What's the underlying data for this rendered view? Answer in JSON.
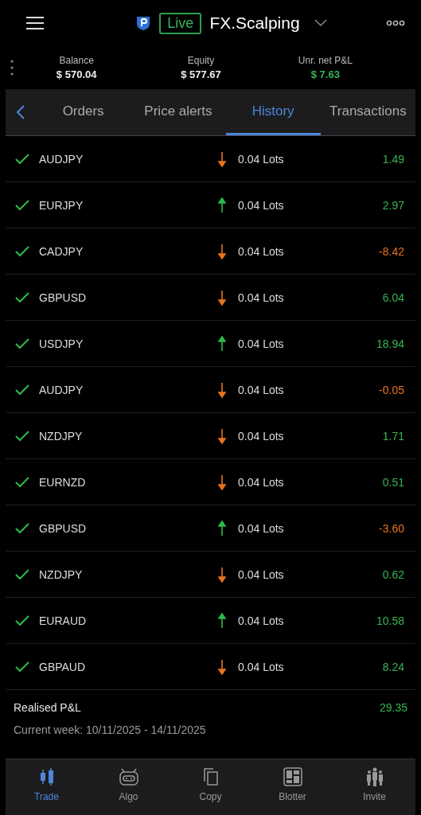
{
  "header": {
    "badge": "Live",
    "account": "FX.Scalping"
  },
  "stats": [
    {
      "label": "Balance",
      "value": "$ 570.04",
      "positive": false
    },
    {
      "label": "Equity",
      "value": "$ 577.67",
      "positive": false
    },
    {
      "label": "Unr. net P&L",
      "value": "$ 7.63",
      "positive": true
    }
  ],
  "tabs": [
    {
      "label": "Orders",
      "selected": false
    },
    {
      "label": "Price alerts",
      "selected": false
    },
    {
      "label": "History",
      "selected": true
    },
    {
      "label": "Transactions",
      "selected": false
    }
  ],
  "rows": [
    {
      "symbol": "AUDJPY",
      "kind": "down",
      "size": "0.04 Lots",
      "pnl": "1.49",
      "loss": false
    },
    {
      "symbol": "EURJPY",
      "kind": "up",
      "size": "0.04 Lots",
      "pnl": "2.97",
      "loss": false
    },
    {
      "symbol": "CADJPY",
      "kind": "down",
      "size": "0.04 Lots",
      "pnl": "-8.42",
      "loss": true
    },
    {
      "symbol": "GBPUSD",
      "kind": "down",
      "size": "0.04 Lots",
      "pnl": "6.04",
      "loss": false
    },
    {
      "symbol": "USDJPY",
      "kind": "up",
      "size": "0.04 Lots",
      "pnl": "18.94",
      "loss": false
    },
    {
      "symbol": "AUDJPY",
      "kind": "down",
      "size": "0.04 Lots",
      "pnl": "-0.05",
      "loss": true
    },
    {
      "symbol": "NZDJPY",
      "kind": "down",
      "size": "0.04 Lots",
      "pnl": "1.71",
      "loss": false
    },
    {
      "symbol": "EURNZD",
      "kind": "down",
      "size": "0.04 Lots",
      "pnl": "0.51",
      "loss": false
    },
    {
      "symbol": "GBPUSD",
      "kind": "up",
      "size": "0.04 Lots",
      "pnl": "-3.60",
      "loss": true
    },
    {
      "symbol": "NZDJPY",
      "kind": "down",
      "size": "0.04 Lots",
      "pnl": "0.62",
      "loss": false
    },
    {
      "symbol": "EURAUD",
      "kind": "up",
      "size": "0.04 Lots",
      "pnl": "10.58",
      "loss": false
    },
    {
      "symbol": "GBPAUD",
      "kind": "down",
      "size": "0.04 Lots",
      "pnl": "8.24",
      "loss": false
    }
  ],
  "summary": {
    "label": "Realised P&L",
    "value": "29.35",
    "loss": false,
    "period": "Current week: 10/11/2025 - 14/11/2025"
  },
  "nav": [
    {
      "kind": "trade",
      "label": "Trade",
      "selected": true
    },
    {
      "kind": "algo",
      "label": "Algo",
      "selected": false
    },
    {
      "kind": "copy",
      "label": "Copy",
      "selected": false
    },
    {
      "kind": "blotter",
      "label": "Blotter",
      "selected": false
    },
    {
      "kind": "invite",
      "label": "Invite",
      "selected": false
    }
  ]
}
